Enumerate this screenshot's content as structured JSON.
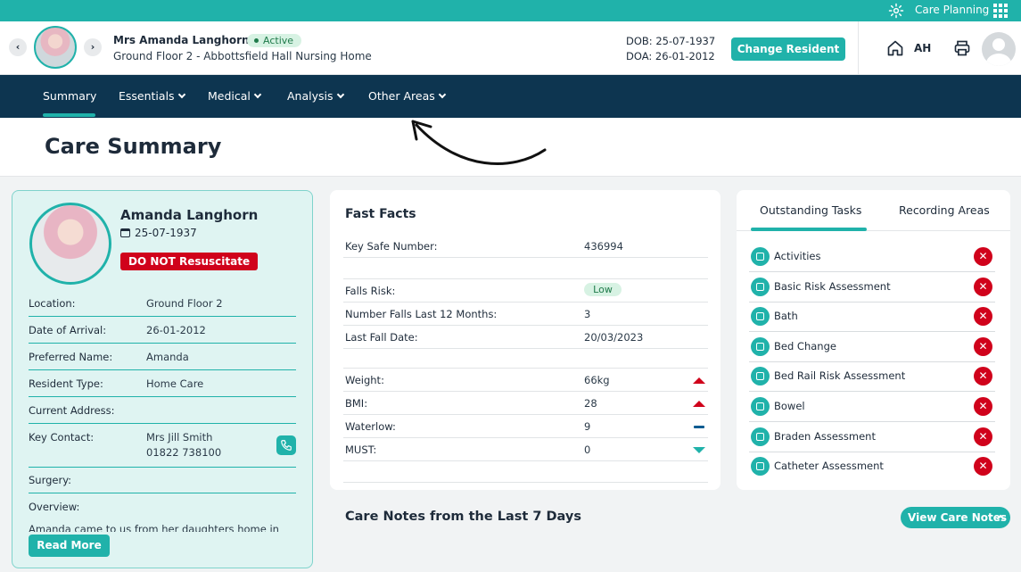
{
  "topbar": {
    "app_name": "Care Planning"
  },
  "header": {
    "resident_name": "Mrs Amanda Langhorn",
    "status": "Active",
    "location": "Ground Floor 2 - Abbottsfield Hall Nursing Home",
    "dob": "DOB: 25-07-1937",
    "doa": "DOA: 26-01-2012",
    "change_label": "Change Resident",
    "user_initials": "AH",
    "prev_glyph": "‹",
    "next_glyph": "›"
  },
  "nav": {
    "items": [
      {
        "label": "Summary"
      },
      {
        "label": "Essentials"
      },
      {
        "label": "Medical"
      },
      {
        "label": "Analysis"
      },
      {
        "label": "Other Areas"
      }
    ]
  },
  "page": {
    "title": "Care Summary"
  },
  "profile": {
    "name": "Amanda Langhorn",
    "dob": "25-07-1937",
    "dnr": "DO NOT Resuscitate",
    "rows": [
      {
        "label": "Location:",
        "value": "Ground Floor 2"
      },
      {
        "label": "Date of Arrival:",
        "value": "26-01-2012"
      },
      {
        "label": "Preferred Name:",
        "value": "Amanda"
      },
      {
        "label": "Resident Type:",
        "value": "Home Care"
      },
      {
        "label": "Current Address:",
        "value": ""
      },
      {
        "label": "Key Contact:",
        "value": "Mrs Jill Smith",
        "value2": "01822 738100"
      },
      {
        "label": "Surgery:",
        "value": ""
      },
      {
        "label": "Overview:",
        "value": ""
      }
    ],
    "overview_text": "Amanda came to us from her daughters home in",
    "read_more": "Read More"
  },
  "facts": {
    "title": "Fast Facts",
    "rows": [
      {
        "label": "Key Safe Number:",
        "value": "436994"
      },
      {
        "label": "Falls Risk:",
        "value": "Low"
      },
      {
        "label": "Number Falls Last 12 Months:",
        "value": "3"
      },
      {
        "label": "Last Fall Date:",
        "value": "20/03/2023"
      },
      {
        "label": "Weight:",
        "value": "66kg",
        "trend": "up"
      },
      {
        "label": "BMI:",
        "value": "28",
        "trend": "up"
      },
      {
        "label": "Waterlow:",
        "value": "9",
        "trend": "flat"
      },
      {
        "label": "MUST:",
        "value": "0",
        "trend": "down"
      }
    ]
  },
  "tasks": {
    "tabs": [
      {
        "label": "Outstanding Tasks",
        "active": true
      },
      {
        "label": "Recording Areas",
        "active": false
      }
    ],
    "items": [
      {
        "label": "Activities"
      },
      {
        "label": "Basic Risk Assessment"
      },
      {
        "label": "Bath"
      },
      {
        "label": "Bed Change"
      },
      {
        "label": "Bed Rail Risk Assessment"
      },
      {
        "label": "Bowel"
      },
      {
        "label": "Braden Assessment"
      },
      {
        "label": "Catheter Assessment"
      }
    ],
    "remove_glyph": "✕"
  },
  "notes": {
    "title": "Care Notes from the Last 7 Days",
    "view_label": "View Care Notes"
  },
  "colors": {
    "accent": "#20b2aa",
    "navy": "#0d3550",
    "danger": "#d0021b"
  }
}
